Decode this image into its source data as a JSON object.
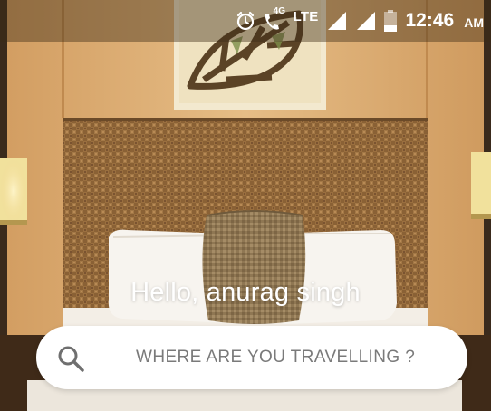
{
  "status_bar": {
    "network_type": "4G",
    "lte_label": "LTE",
    "time": "12:46",
    "ampm": "AM"
  },
  "icons": {
    "alarm": "alarm-clock-icon",
    "call": "wifi-calling-icon",
    "signal_1": "cell-signal-icon",
    "signal_2": "cell-signal-icon",
    "battery": "battery-icon",
    "search": "search-icon"
  },
  "main": {
    "greeting": "Hello, anurag singh"
  },
  "search": {
    "placeholder": "WHERE ARE YOU TRAVELLING ?"
  },
  "colors": {
    "status_text": "#ffffff",
    "placeholder": "#7a7a7a",
    "search_bg": "#ffffff"
  }
}
